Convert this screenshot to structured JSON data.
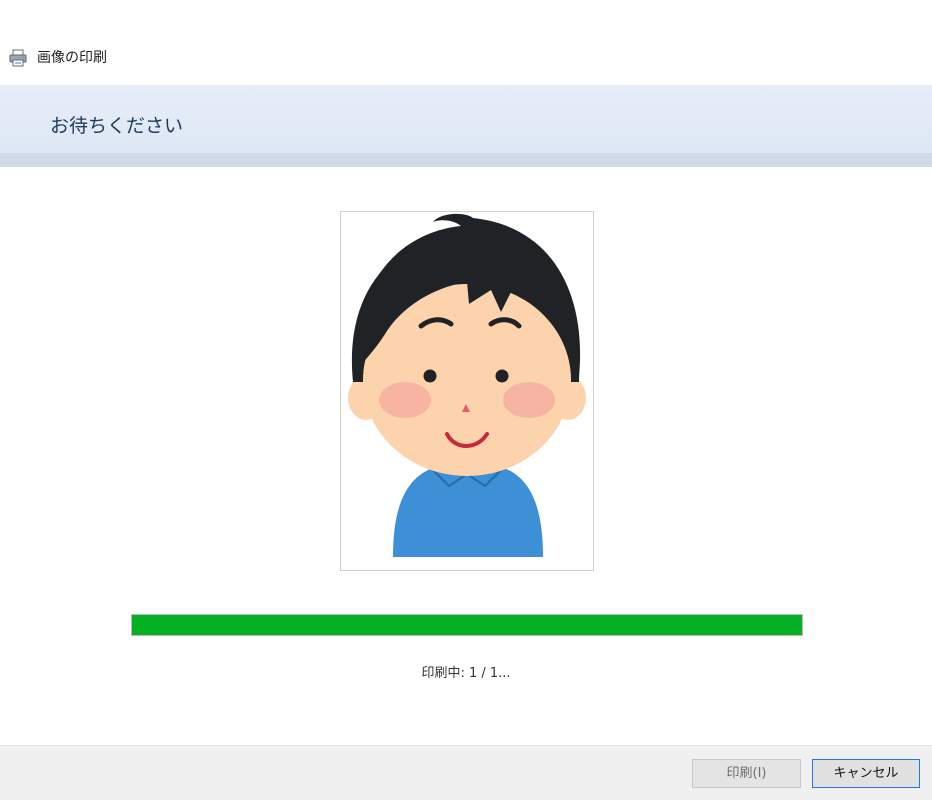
{
  "window": {
    "title": "画像の印刷",
    "icon": "printer-icon"
  },
  "header": {
    "heading": "お待ちください"
  },
  "preview": {
    "image": "boy-illustration"
  },
  "progress": {
    "fraction": 1.0,
    "color": "#06b025",
    "status": "印刷中: 1 / 1..."
  },
  "buttons": {
    "print_label": "印刷(I)",
    "cancel_label": "キャンセル"
  }
}
